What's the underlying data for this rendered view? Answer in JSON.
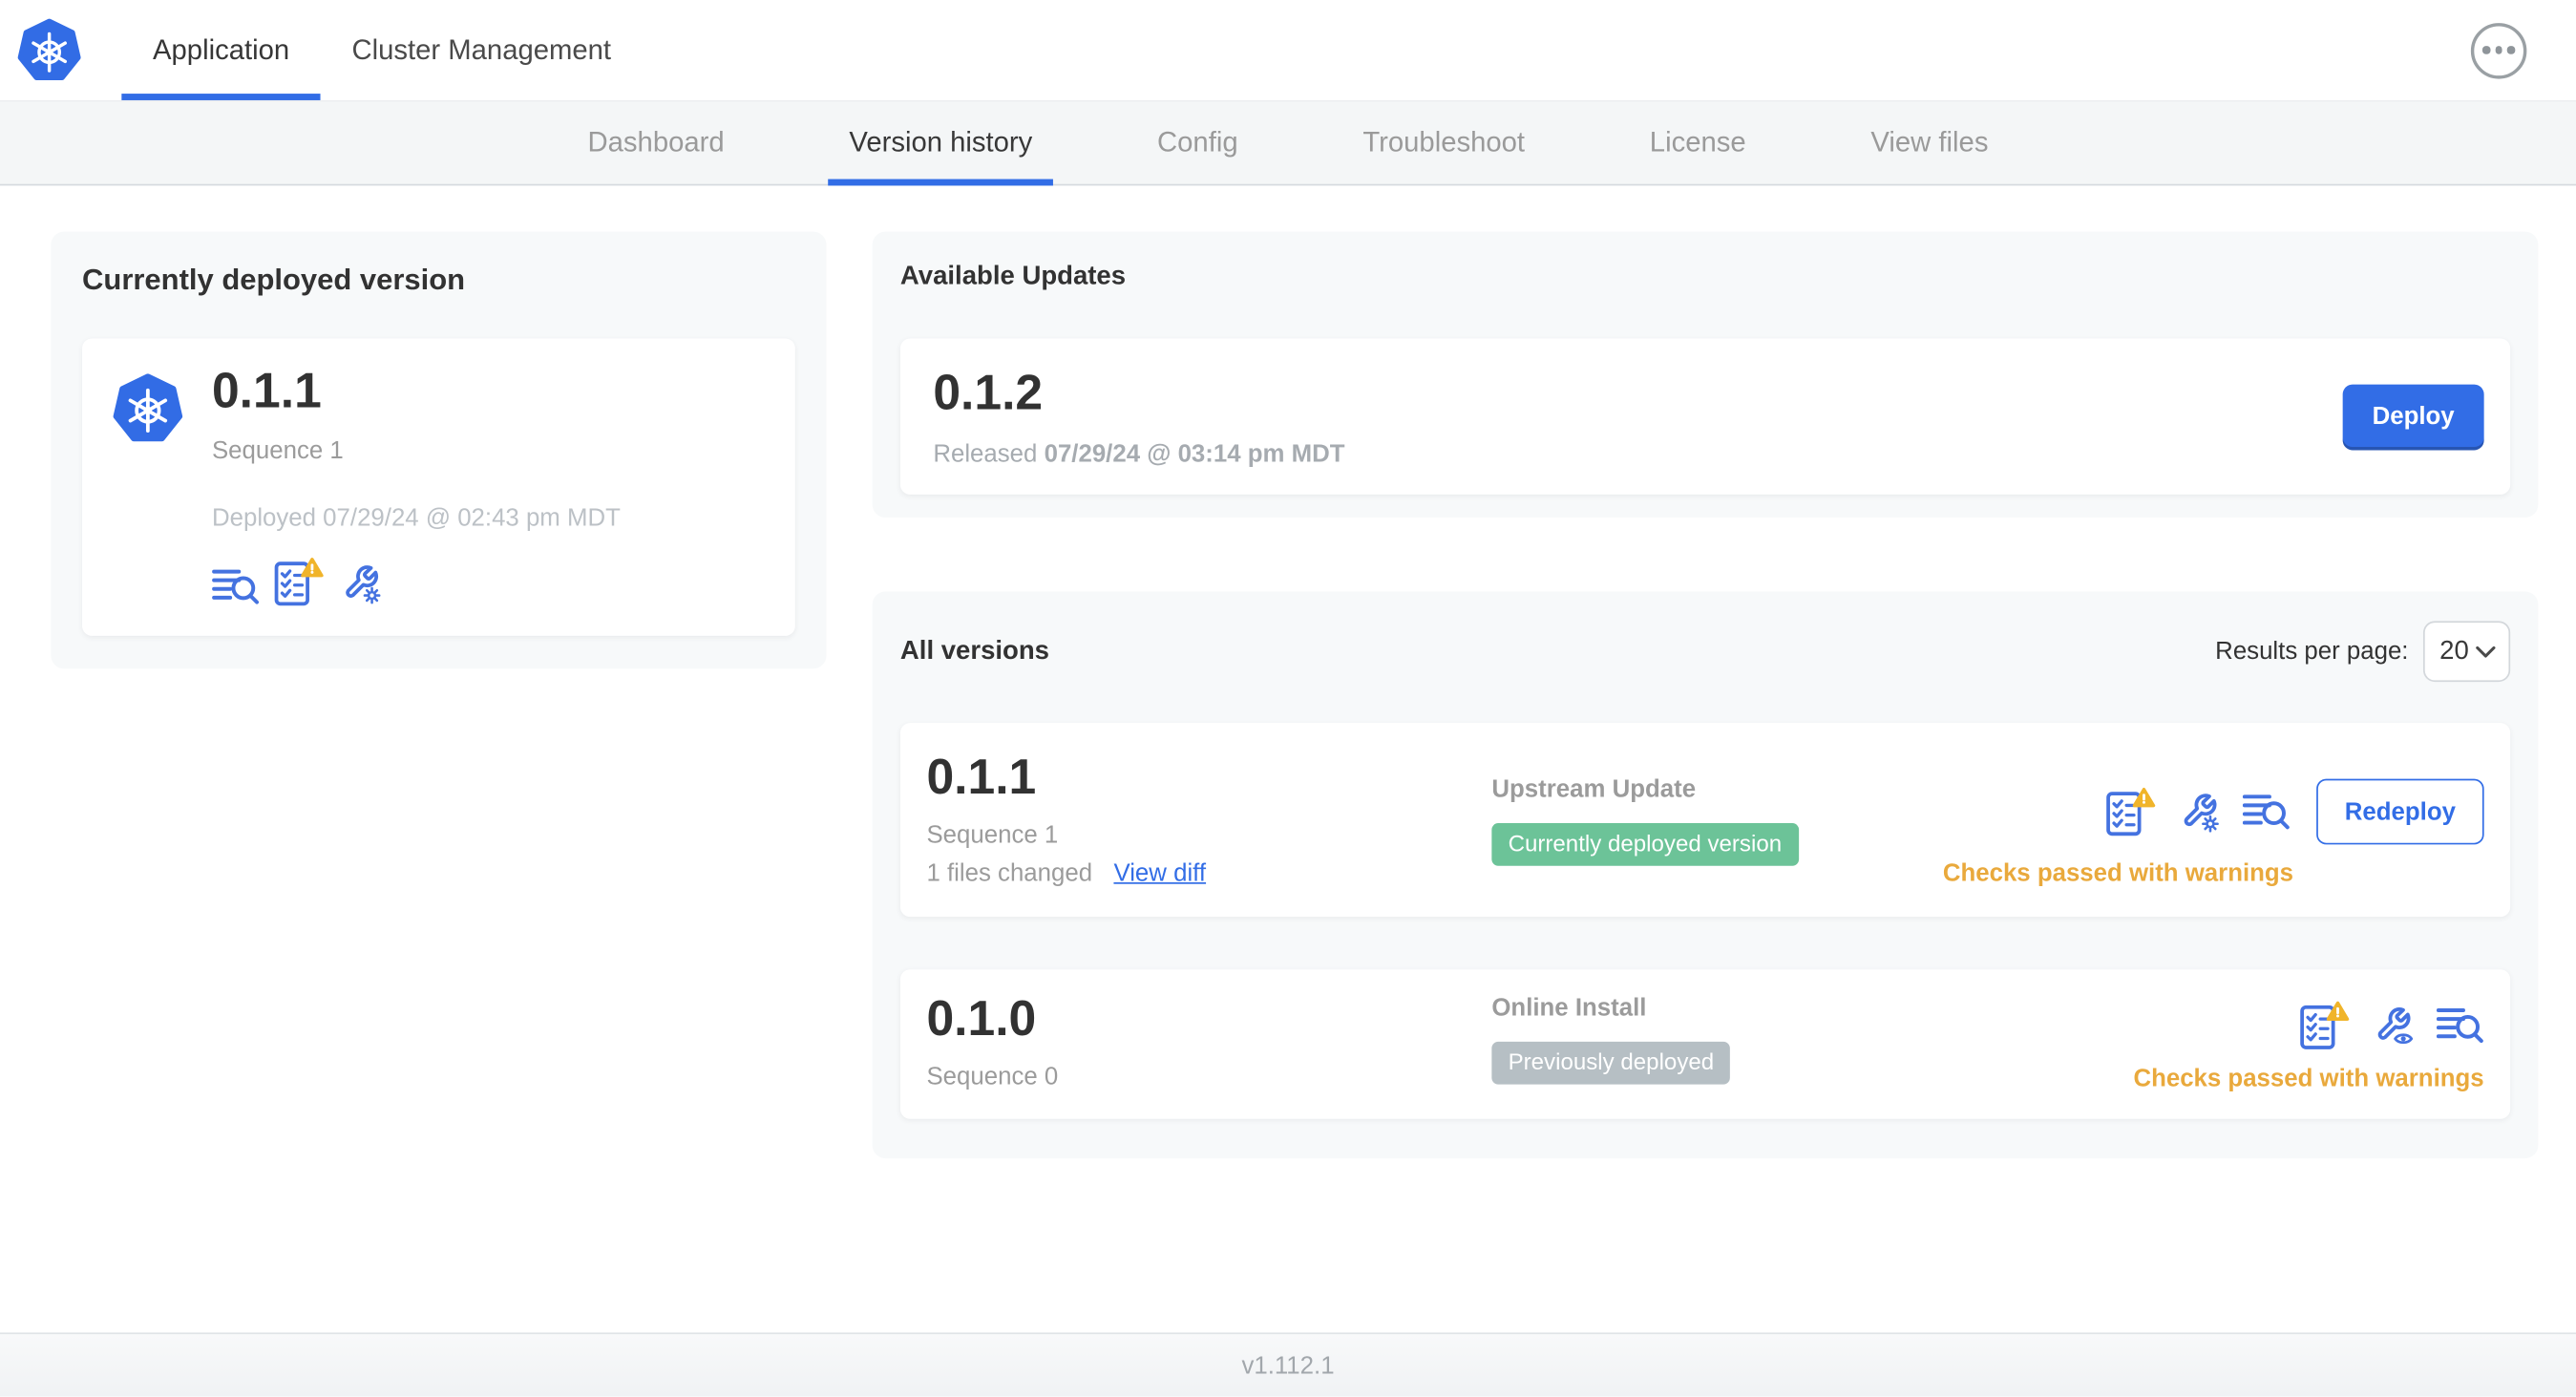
{
  "topnav": {
    "tabs": [
      {
        "label": "Application",
        "active": true
      },
      {
        "label": "Cluster Management",
        "active": false
      }
    ]
  },
  "subnav": {
    "tabs": [
      "Dashboard",
      "Version history",
      "Config",
      "Troubleshoot",
      "License",
      "View files"
    ],
    "active": "Version history"
  },
  "currently_deployed": {
    "title": "Currently deployed version",
    "version": "0.1.1",
    "sequence": "Sequence 1",
    "deployed": "Deployed 07/29/24 @ 02:43 pm MDT"
  },
  "available_updates": {
    "title": "Available Updates",
    "version": "0.1.2",
    "released_prefix": "Released",
    "released_date": "07/29/24 @ 03:14 pm MDT",
    "deploy_label": "Deploy"
  },
  "all_versions": {
    "title": "All versions",
    "results_per_page_label": "Results per page:",
    "results_per_page_value": "20",
    "rows": [
      {
        "version": "0.1.1",
        "sequence": "Sequence 1",
        "files_changed": "1 files changed",
        "view_diff_label": "View diff",
        "source": "Upstream Update",
        "badge": "Currently deployed version",
        "badge_type": "green",
        "action_label": "Redeploy",
        "checks_status": "Checks passed with warnings"
      },
      {
        "version": "0.1.0",
        "sequence": "Sequence 0",
        "source": "Online Install",
        "badge": "Previously deployed",
        "badge_type": "gray",
        "checks_status": "Checks passed with warnings"
      }
    ]
  },
  "footer": {
    "app_version": "v1.112.1"
  },
  "colors": {
    "accent_blue": "#326de6",
    "icon_blue": "#4472e0",
    "warning_yellow": "#e9a93c",
    "badge_green": "#6cc398",
    "badge_gray": "#b6bfc4"
  },
  "icons": {
    "brand": "kubernetes-logo",
    "overflow": "ellipsis-icon",
    "diff": "view-diff-icon",
    "preflight": "preflight-checks-warning-icon",
    "edit_config": "wrench-gear-icon",
    "view_config": "wrench-eye-icon",
    "select_caret": "chevron-down-icon"
  }
}
